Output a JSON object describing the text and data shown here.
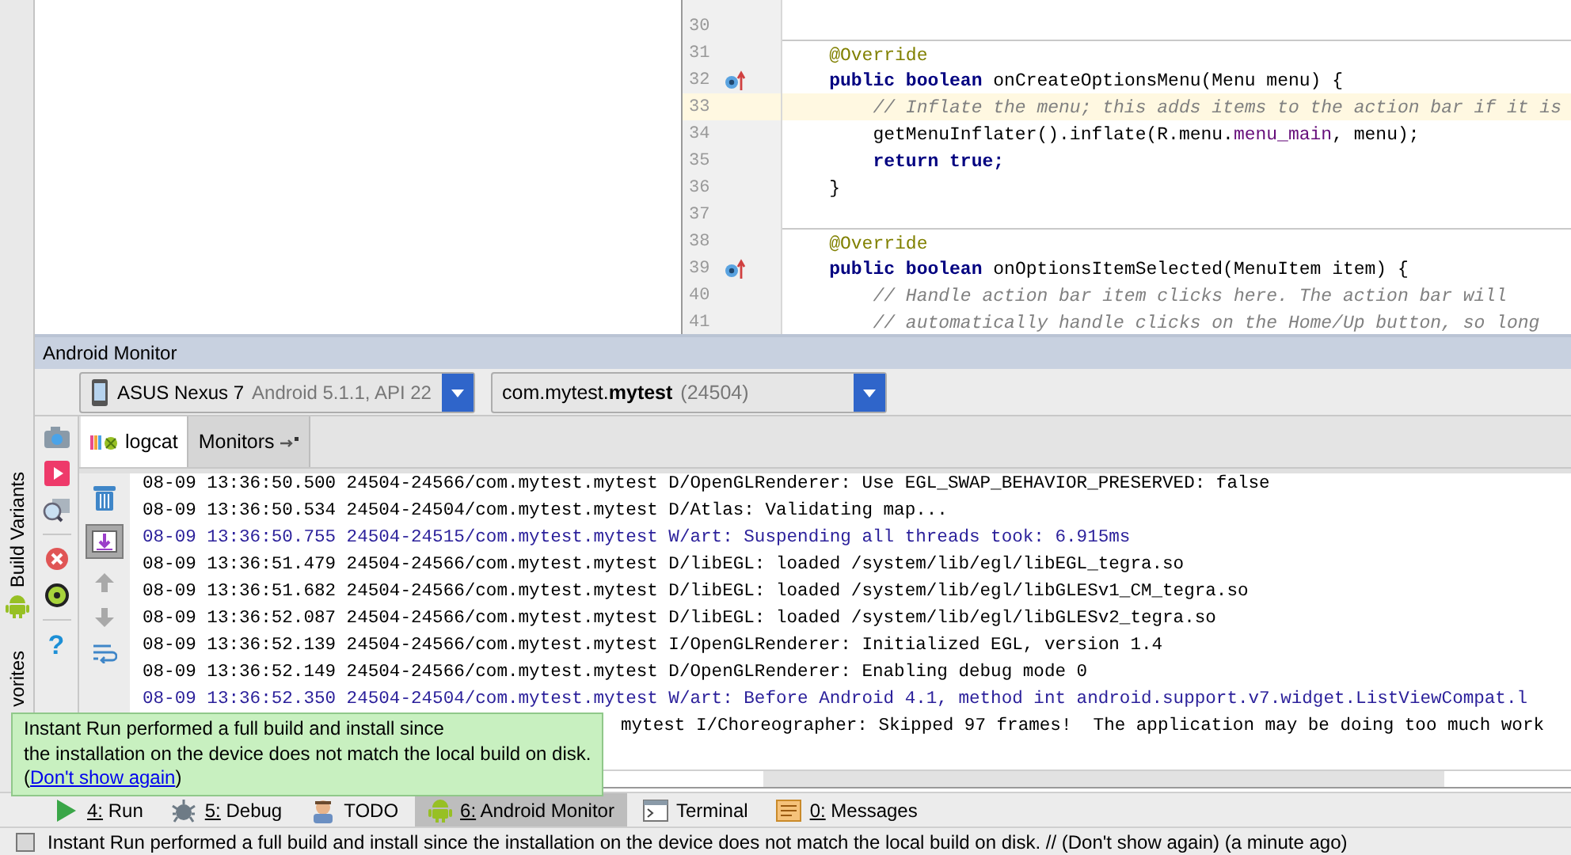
{
  "side_tabs": [
    {
      "label": "Build Variants",
      "kind": "android"
    },
    {
      "label": "vorites",
      "kind": "plain"
    }
  ],
  "editor": {
    "lines": [
      {
        "number": "30",
        "current": false,
        "override": false,
        "separator": false
      },
      {
        "number": "31",
        "current": false,
        "override": false,
        "separator": true,
        "tokens": [
          {
            "kind": "annotation",
            "text": "    @Override"
          }
        ]
      },
      {
        "number": "32",
        "current": false,
        "override": true,
        "separator": false,
        "tokens": [
          {
            "kind": "keyword",
            "text": "    public boolean"
          },
          {
            "kind": "plain",
            "text": " onCreateOptionsMenu(Menu menu) {"
          }
        ]
      },
      {
        "number": "33",
        "current": true,
        "override": false,
        "separator": false,
        "tokens": [
          {
            "kind": "comment",
            "text": "        // Inflate the menu; this adds items to the action bar if it is"
          }
        ]
      },
      {
        "number": "34",
        "current": false,
        "override": false,
        "separator": false,
        "tokens": [
          {
            "kind": "plain",
            "text": "        getMenuInflater().inflate(R.menu."
          },
          {
            "kind": "field",
            "text": "menu_main"
          },
          {
            "kind": "plain",
            "text": ", menu);"
          }
        ]
      },
      {
        "number": "35",
        "current": false,
        "override": false,
        "separator": false,
        "tokens": [
          {
            "kind": "keyword",
            "text": "        return true;"
          }
        ]
      },
      {
        "number": "36",
        "current": false,
        "override": false,
        "separator": false,
        "tokens": [
          {
            "kind": "plain",
            "text": "    }"
          }
        ]
      },
      {
        "number": "37",
        "current": false,
        "override": false,
        "separator": false
      },
      {
        "number": "38",
        "current": false,
        "override": false,
        "separator": true,
        "tokens": [
          {
            "kind": "annotation",
            "text": "    @Override"
          }
        ]
      },
      {
        "number": "39",
        "current": false,
        "override": true,
        "separator": false,
        "tokens": [
          {
            "kind": "keyword",
            "text": "    public boolean"
          },
          {
            "kind": "plain",
            "text": " onOptionsItemSelected(MenuItem item) {"
          }
        ]
      },
      {
        "number": "40",
        "current": false,
        "override": false,
        "separator": false,
        "tokens": [
          {
            "kind": "comment",
            "text": "        // Handle action bar item clicks here. The action bar will"
          }
        ]
      },
      {
        "number": "41",
        "current": false,
        "override": false,
        "separator": false,
        "tokens": [
          {
            "kind": "comment",
            "text": "        // automatically handle clicks on the Home/Up button, so long"
          }
        ]
      }
    ]
  },
  "monitor": {
    "title": "Android Monitor",
    "device": {
      "name": "ASUS Nexus 7",
      "detail": "Android 5.1.1, API 22"
    },
    "process": {
      "name": "com.mytest.**mytest**",
      "pid": "(24504)"
    },
    "tabs": [
      {
        "label": "logcat",
        "selected": true
      },
      {
        "label": "Monitors",
        "selected": false
      }
    ],
    "scroll_to_end": true,
    "help_label": "?",
    "log_lines": [
      {
        "color": "#000000",
        "covered": false,
        "text": "08-09 13:36:50.500 24504-24566/com.mytest.mytest D/OpenGLRenderer: Use EGL_SWAP_BEHAVIOR_PRESERVED: false"
      },
      {
        "color": "#000000",
        "covered": false,
        "text": "08-09 13:36:50.534 24504-24504/com.mytest.mytest D/Atlas: Validating map..."
      },
      {
        "color": "#2a1f9a",
        "covered": false,
        "text": "08-09 13:36:50.755 24504-24515/com.mytest.mytest W/art: Suspending all threads took: 6.915ms"
      },
      {
        "color": "#000000",
        "covered": false,
        "text": "08-09 13:36:51.479 24504-24566/com.mytest.mytest D/libEGL: loaded /system/lib/egl/libEGL_tegra.so"
      },
      {
        "color": "#000000",
        "covered": false,
        "text": "08-09 13:36:51.682 24504-24566/com.mytest.mytest D/libEGL: loaded /system/lib/egl/libGLESv1_CM_tegra.so"
      },
      {
        "color": "#000000",
        "covered": false,
        "text": "08-09 13:36:52.087 24504-24566/com.mytest.mytest D/libEGL: loaded /system/lib/egl/libGLESv2_tegra.so"
      },
      {
        "color": "#000000",
        "covered": false,
        "text": "08-09 13:36:52.139 24504-24566/com.mytest.mytest I/OpenGLRenderer: Initialized EGL, version 1.4"
      },
      {
        "color": "#000000",
        "covered": false,
        "text": "08-09 13:36:52.149 24504-24566/com.mytest.mytest D/OpenGLRenderer: Enabling debug mode 0"
      },
      {
        "color": "#2a1f9a",
        "covered": false,
        "text": "08-09 13:36:52.350 24504-24504/com.mytest.mytest W/art: Before Android 4.1, method int android.support.v7.widget.ListViewCompat.l"
      },
      {
        "color": "#000000",
        "covered": true,
        "text": "mytest I/Choreographer: Skipped 97 frames!  The application may be doing too much work"
      }
    ]
  },
  "popup": {
    "lines": [
      "Instant Run performed a full build and install since",
      "the installation on the device does not match the local build on disk."
    ],
    "before_link": "(",
    "link": "Don't show again",
    "after_link": ")"
  },
  "tool_windows": [
    {
      "label": "4: Run",
      "mnemonic": true,
      "selected": false
    },
    {
      "label": "5: Debug",
      "mnemonic": true,
      "selected": false
    },
    {
      "label": "TODO",
      "mnemonic": false,
      "selected": false
    },
    {
      "label": "6: Android Monitor",
      "mnemonic": true,
      "selected": true
    },
    {
      "label": "Terminal",
      "mnemonic": false,
      "selected": false
    },
    {
      "label": "0: Messages",
      "mnemonic": true,
      "selected": false
    }
  ],
  "status_bar": {
    "text": "Instant Run performed a full build and install since the installation on the device does not match the local build on disk. // (Don't show again) (a minute ago)"
  }
}
